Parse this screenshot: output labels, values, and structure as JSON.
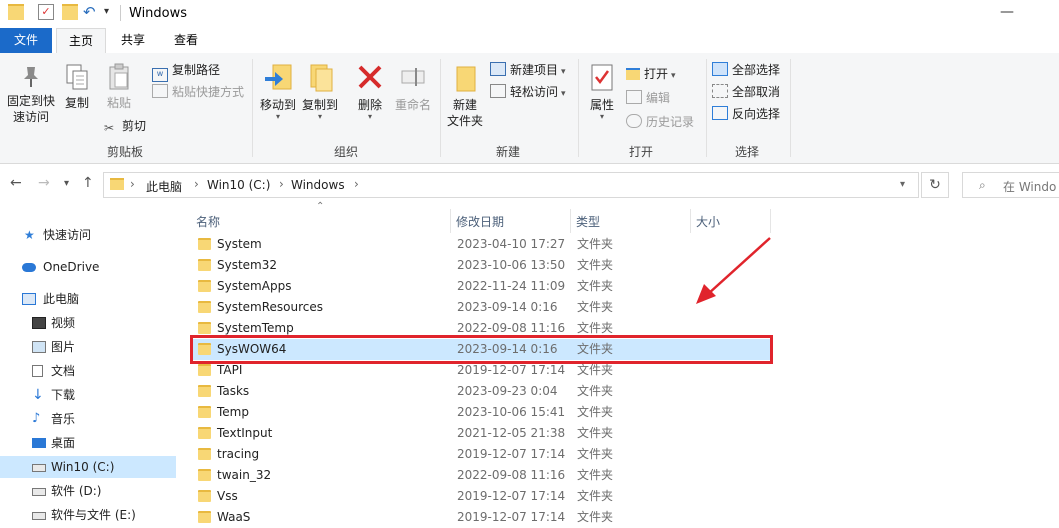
{
  "window": {
    "title": "Windows"
  },
  "tabs": {
    "file": "文件",
    "home": "主页",
    "share": "共享",
    "view": "查看"
  },
  "ribbon": {
    "clipboard": {
      "label": "剪贴板",
      "pin_line1": "固定到快",
      "pin_line2": "速访问",
      "copy": "复制",
      "paste": "粘贴",
      "copy_path": "复制路径",
      "paste_shortcut": "粘贴快捷方式",
      "cut": "剪切"
    },
    "organize": {
      "label": "组织",
      "move_to": "移动到",
      "copy_to": "复制到",
      "delete": "删除",
      "rename": "重命名"
    },
    "new": {
      "label": "新建",
      "new_folder_line1": "新建",
      "new_folder_line2": "文件夹",
      "new_item": "新建项目",
      "easy_access": "轻松访问"
    },
    "open": {
      "label": "打开",
      "properties": "属性",
      "open": "打开",
      "edit": "编辑",
      "history": "历史记录"
    },
    "select": {
      "label": "选择",
      "select_all": "全部选择",
      "select_none": "全部取消",
      "invert": "反向选择"
    }
  },
  "address": {
    "crumbs": [
      "此电脑",
      "Win10 (C:)",
      "Windows"
    ],
    "search_placeholder": "在 Windo"
  },
  "nav": {
    "quick_access": "快速访问",
    "onedrive": "OneDrive",
    "this_pc": "此电脑",
    "videos": "视频",
    "pictures": "图片",
    "documents": "文档",
    "downloads": "下载",
    "music": "音乐",
    "desktop": "桌面",
    "drive_c": "Win10 (C:)",
    "drive_d": "软件 (D:)",
    "drive_e": "软件与文件 (E:)"
  },
  "columns": {
    "name": "名称",
    "date": "修改日期",
    "type": "类型",
    "size": "大小"
  },
  "files": [
    {
      "name": "System",
      "date": "2023-04-10 17:27",
      "type": "文件夹"
    },
    {
      "name": "System32",
      "date": "2023-10-06 13:50",
      "type": "文件夹"
    },
    {
      "name": "SystemApps",
      "date": "2022-11-24 11:09",
      "type": "文件夹"
    },
    {
      "name": "SystemResources",
      "date": "2023-09-14 0:16",
      "type": "文件夹"
    },
    {
      "name": "SystemTemp",
      "date": "2022-09-08 11:16",
      "type": "文件夹"
    },
    {
      "name": "SysWOW64",
      "date": "2023-09-14 0:16",
      "type": "文件夹"
    },
    {
      "name": "TAPI",
      "date": "2019-12-07 17:14",
      "type": "文件夹"
    },
    {
      "name": "Tasks",
      "date": "2023-09-23 0:04",
      "type": "文件夹"
    },
    {
      "name": "Temp",
      "date": "2023-10-06 15:41",
      "type": "文件夹"
    },
    {
      "name": "TextInput",
      "date": "2021-12-05 21:38",
      "type": "文件夹"
    },
    {
      "name": "tracing",
      "date": "2019-12-07 17:14",
      "type": "文件夹"
    },
    {
      "name": "twain_32",
      "date": "2022-09-08 11:16",
      "type": "文件夹"
    },
    {
      "name": "Vss",
      "date": "2019-12-07 17:14",
      "type": "文件夹"
    },
    {
      "name": "WaaS",
      "date": "2019-12-07 17:14",
      "type": "文件夹"
    }
  ],
  "colors": {
    "accent": "#1b6ac9",
    "selection": "#cce8ff",
    "highlight_box": "#e0242c",
    "arrow": "#e0242c",
    "folder": "#f8d775"
  }
}
